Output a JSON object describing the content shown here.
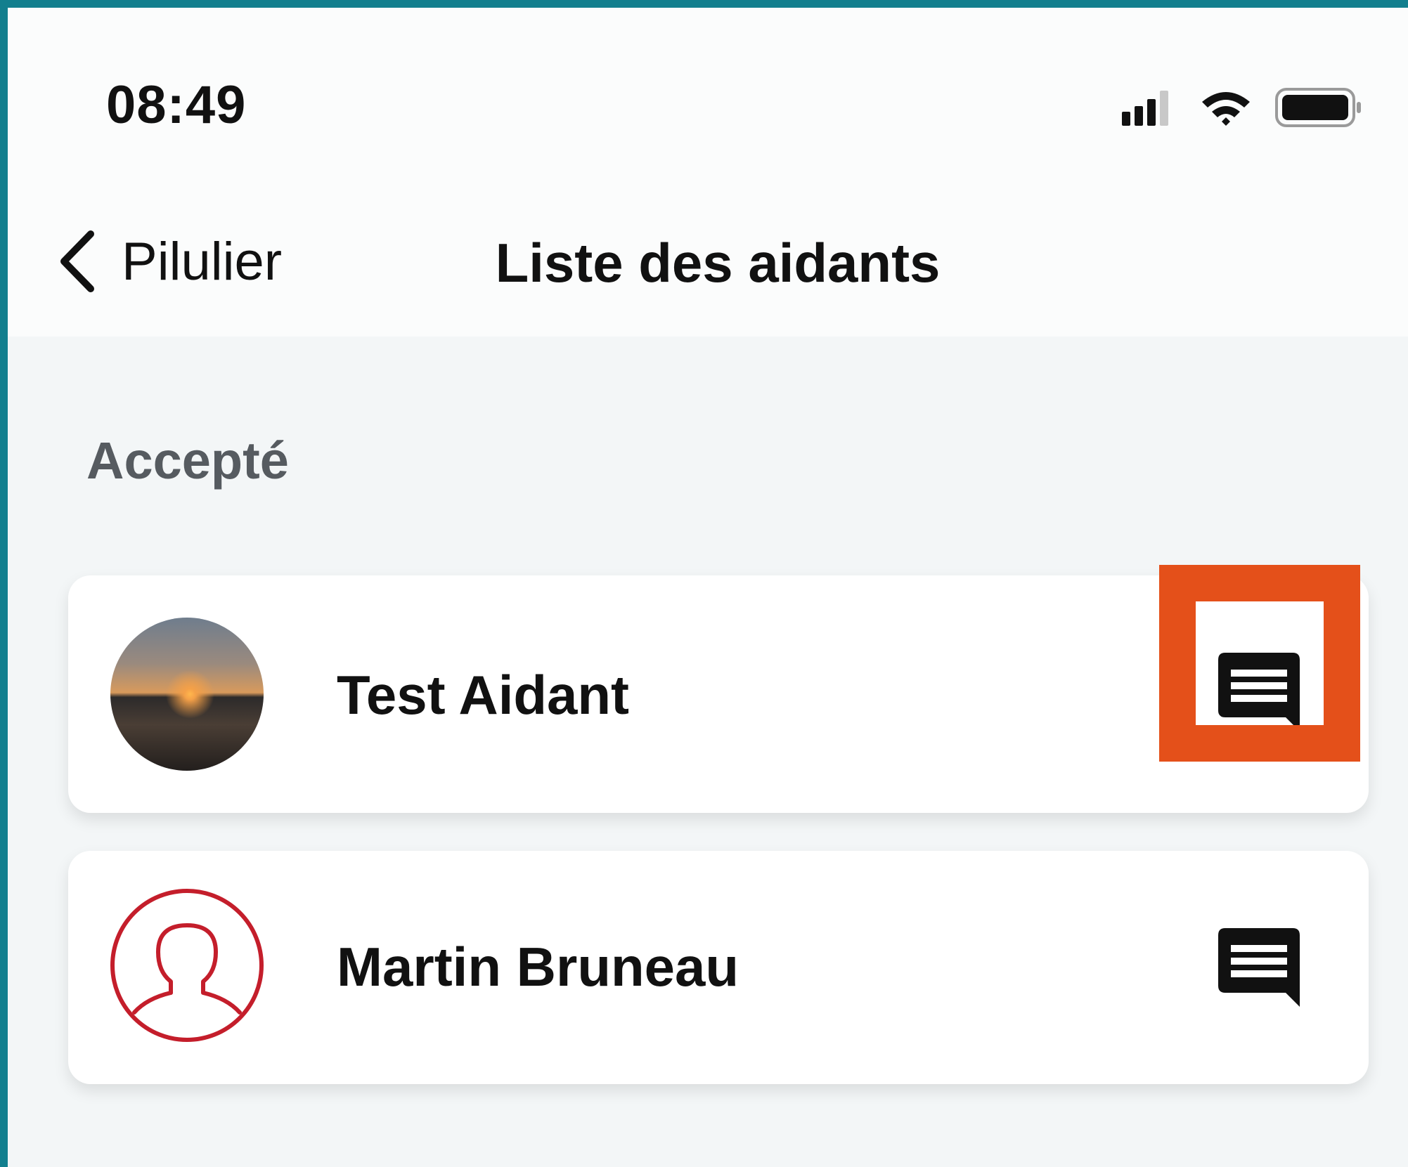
{
  "status_bar": {
    "time": "08:49",
    "icons": [
      "signal-icon",
      "wifi-icon",
      "battery-icon"
    ]
  },
  "nav": {
    "back_label": "Pilulier",
    "title": "Liste des aidants"
  },
  "section": {
    "label": "Accepté"
  },
  "caregivers": [
    {
      "name": "Test Aidant",
      "avatar": "photo",
      "action_icon": "message-icon"
    },
    {
      "name": "Martin Bruneau",
      "avatar": "person-outline-icon",
      "action_icon": "message-icon"
    }
  ],
  "colors": {
    "frame_border": "#127f8e",
    "highlight": "#e4501a",
    "avatar_outline": "#c41e2b"
  }
}
